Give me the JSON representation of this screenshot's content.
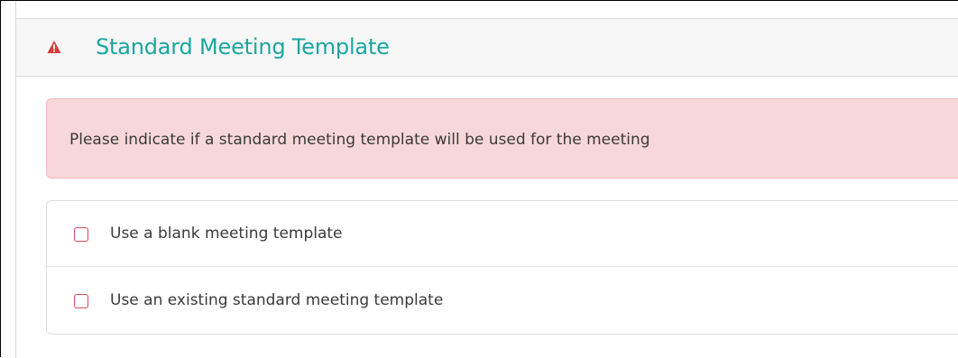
{
  "section": {
    "title": "Standard Meeting Template",
    "warning_icon": "warning-triangle-icon",
    "warning_color": "#d63b3b",
    "title_color": "#1aa6a0"
  },
  "alert": {
    "message": "Please indicate if a standard meeting template will be used for the meeting",
    "background": "#f8d7da"
  },
  "options": [
    {
      "label": "Use a blank meeting template",
      "checked": false
    },
    {
      "label": "Use an existing standard meeting template",
      "checked": false
    }
  ],
  "checkbox_border_color": "#d24b58"
}
